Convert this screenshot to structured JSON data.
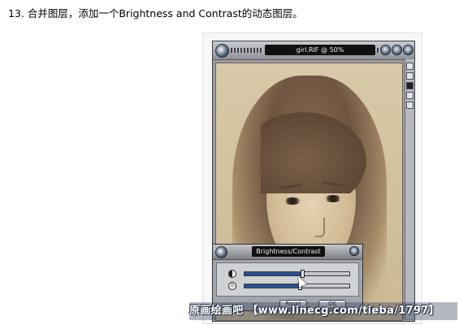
{
  "heading": "13. 合并图层，添加一个Brightness and Contrast的动态图层。",
  "app": {
    "document_title": "girl.RIF @ 50%"
  },
  "bc_palette": {
    "title": "Brightness/Contrast",
    "contrast_level": 0.55,
    "brightness_level": 0.53,
    "reset_label": "Reset",
    "ok_label": "OK"
  },
  "watermark": "原画绘画吧 【www.linecg.com/tieba/1797】"
}
